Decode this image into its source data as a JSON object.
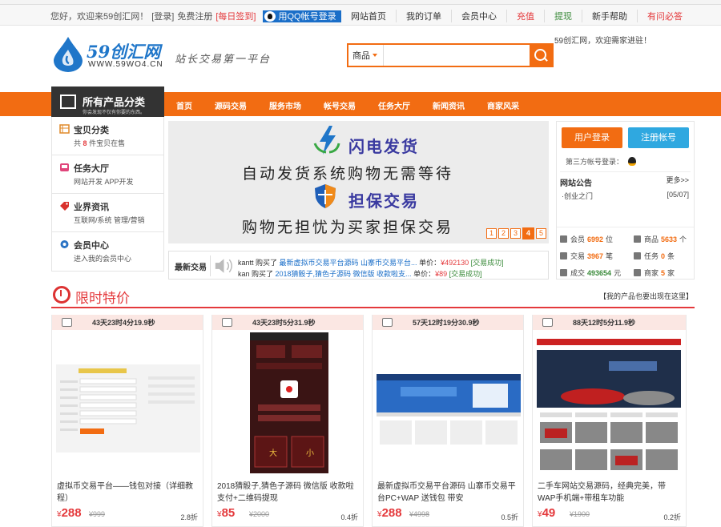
{
  "topbar": {
    "welcome": "您好，欢迎来59创汇网！",
    "login": "[登录]",
    "register": "免费注册",
    "checkin": "[每日签到]",
    "qq_login": "用QQ帐号登录",
    "links": [
      "网站首页",
      "我的订单",
      "会员中心",
      "充值",
      "提现",
      "新手帮助",
      "有问必答"
    ]
  },
  "header": {
    "logo_name": "59创汇网",
    "logo_url": "WWW.59WO4.CN",
    "slogan": "站长交易第一平台",
    "search_category": "商品",
    "search_value": "",
    "welcome2": "59创汇网，欢迎需家进驻！"
  },
  "nav": {
    "all_categories": "所有产品分类",
    "all_categories_sub": "你会发现不仅有你要的东西。",
    "items": [
      "首页",
      "源码交易",
      "服务市场",
      "帐号交易",
      "任务大厅",
      "新闻资讯",
      "商家风采"
    ]
  },
  "categories": [
    {
      "title": "宝贝分类",
      "sub_prefix": "共",
      "count": "8",
      "sub_suffix": "件宝贝在售"
    },
    {
      "title": "任务大厅",
      "sub": "网站开发   APP开发"
    },
    {
      "title": "业界资讯",
      "sub": "互联网/系统 管理/营销"
    },
    {
      "title": "会员中心",
      "sub": "进入我的会员中心"
    }
  ],
  "banner": {
    "line1": "闪电发货",
    "line2": "自动发货系统购物无需等待",
    "line3": "担保交易",
    "line4": "购物无担忧为买家担保交易",
    "pages": [
      "1",
      "2",
      "3",
      "4",
      "5"
    ],
    "active_page": "4"
  },
  "ticker": {
    "label": "最新交易",
    "rows": [
      {
        "buyer": "kantt 购买了",
        "item": "最新虚拟币交易平台源码 山寨币交易平台...",
        "price_label": "单价：",
        "price": "¥492130",
        "status": "[交易成功]"
      },
      {
        "buyer": "kan 购买了",
        "item": "2018猜骰子,猜色子源码 微信版 收款啦支...",
        "price_label": "单价：",
        "price": "¥89",
        "status": "[交易成功]"
      }
    ]
  },
  "account": {
    "login_btn": "用户登录",
    "register_btn": "注册帐号",
    "third_party": "第三方帐号登录：",
    "notice_title": "网站公告",
    "notice_more": "更多>>",
    "notice_item": "·创业之门",
    "notice_date": "[05/07]",
    "stats": [
      {
        "label": "会员",
        "value": "6992",
        "unit": "位"
      },
      {
        "label": "商品",
        "value": "5633",
        "unit": "个"
      },
      {
        "label": "交易",
        "value": "3967",
        "unit": "笔"
      },
      {
        "label": "任务",
        "value": "0",
        "unit": "条"
      },
      {
        "label": "成交",
        "value": "493654",
        "unit": "元"
      },
      {
        "label": "商家",
        "value": "5",
        "unit": "家"
      }
    ]
  },
  "flash_sale": {
    "title": "限时特价",
    "right_text": "【我的产品也要出现在这里】",
    "products": [
      {
        "countdown": "43天23时4分19.9秒",
        "name": "虚拟币交易平台——钱包对接（详细教程）",
        "price": "288",
        "old_price": "¥999",
        "discount": "2.8折"
      },
      {
        "countdown": "43天23时5分31.9秒",
        "name": "2018猜骰子,猜色子源码 微信版 收款啦支付+二维码提现",
        "price": "85",
        "old_price": "¥2000",
        "discount": "0.4折"
      },
      {
        "countdown": "57天12时19分30.9秒",
        "name": "最新虚拟币交易平台源码 山寨币交易平台PC+WAP 送钱包 带安",
        "price": "288",
        "old_price": "¥4998",
        "discount": "0.5折"
      },
      {
        "countdown": "88天12时5分11.9秒",
        "name": "二手车网站交易源码，经典完美，带WAP手机端+带租车功能",
        "price": "49",
        "old_price": "¥1900",
        "discount": "0.2折"
      }
    ]
  },
  "colors": {
    "accent": "#f26c12",
    "red": "#e4393c",
    "blue": "#1a6ec8",
    "sky": "#2fa8e0"
  }
}
